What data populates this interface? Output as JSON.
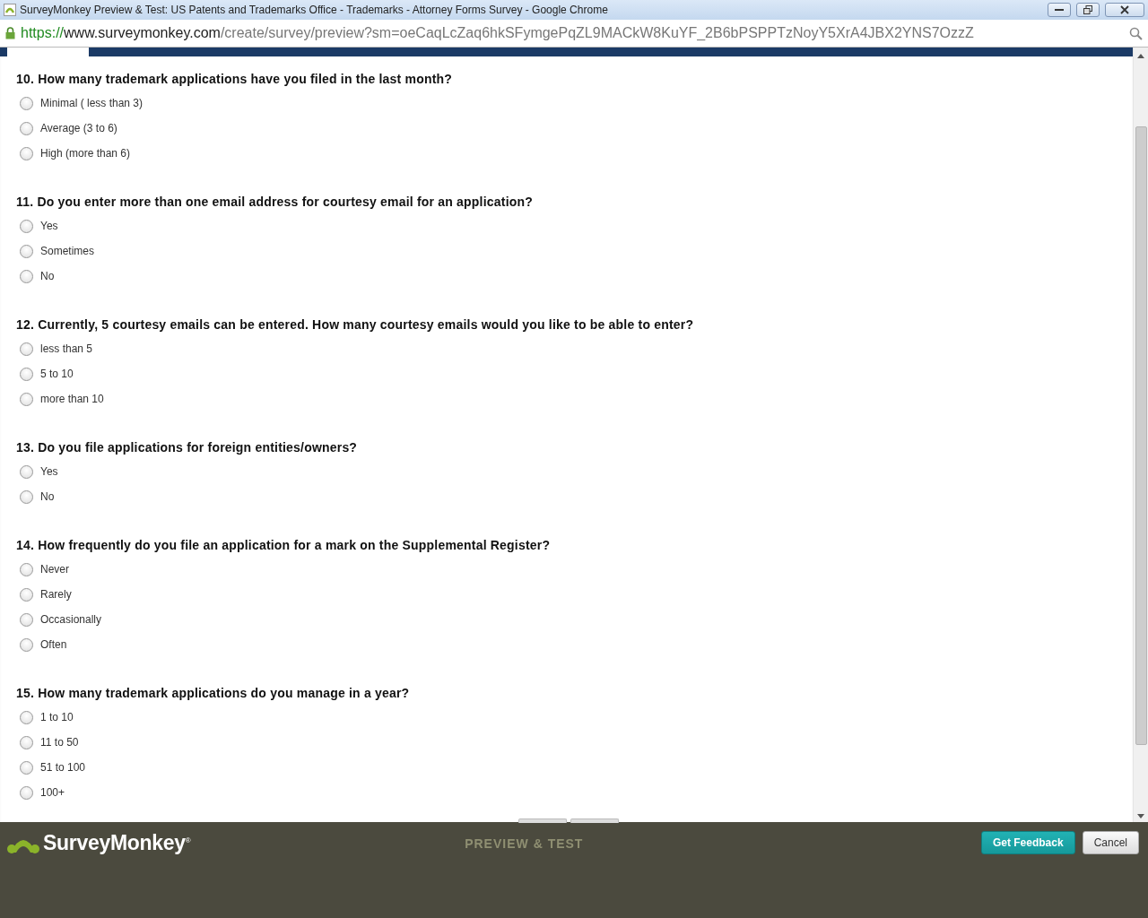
{
  "window": {
    "title": "SurveyMonkey Preview & Test: US Patents and Trademarks Office - Trademarks - Attorney Forms Survey - Google Chrome"
  },
  "address_bar": {
    "scheme": "https://",
    "host": "www.surveymonkey.com",
    "path": "/create/survey/preview?sm=oeCaqLcZaq6hkSFymgePqZL9MACkW8KuYF_2B6bPSPPTzNoyY5XrA4JBX2YNS7OzzZ"
  },
  "questions": [
    {
      "title": "10. How many trademark applications have you filed in the last month?",
      "options": [
        {
          "label": "Minimal ( less than 3)",
          "selected": false
        },
        {
          "label": "Average (3 to 6)",
          "selected": false
        },
        {
          "label": "High (more than 6)",
          "selected": false
        }
      ]
    },
    {
      "title": "11. Do you enter more than one email address for courtesy email for an application?",
      "options": [
        {
          "label": "Yes",
          "selected": false
        },
        {
          "label": "Sometimes",
          "selected": false
        },
        {
          "label": "No",
          "selected": false
        }
      ]
    },
    {
      "title": "12. Currently, 5 courtesy emails can be entered. How many courtesy emails would you like to be able to enter?",
      "options": [
        {
          "label": "less than 5",
          "selected": false
        },
        {
          "label": "5 to 10",
          "selected": false
        },
        {
          "label": "more than 10",
          "selected": false
        }
      ]
    },
    {
      "title": "13. Do you file applications for foreign entities/owners?",
      "options": [
        {
          "label": "Yes",
          "selected": false
        },
        {
          "label": "No",
          "selected": false
        }
      ]
    },
    {
      "title": "14. How frequently do you file an application for a mark on the Supplemental Register?",
      "options": [
        {
          "label": "Never",
          "selected": false
        },
        {
          "label": "Rarely",
          "selected": false
        },
        {
          "label": "Occasionally",
          "selected": false
        },
        {
          "label": "Often",
          "selected": false
        }
      ]
    },
    {
      "title": "15. How many trademark applications do you manage in a year?",
      "options": [
        {
          "label": "1 to 10",
          "selected": false
        },
        {
          "label": "11 to 50",
          "selected": false
        },
        {
          "label": "51 to 100",
          "selected": false
        },
        {
          "label": "100+",
          "selected": false
        }
      ]
    }
  ],
  "footer": {
    "brand": "SurveyMonkey",
    "brand_mark": "®",
    "mode": "PREVIEW & TEST",
    "buttons": [
      {
        "label": "Get Feedback",
        "kind": "primary"
      },
      {
        "label": "Cancel",
        "kind": "secondary"
      }
    ]
  }
}
